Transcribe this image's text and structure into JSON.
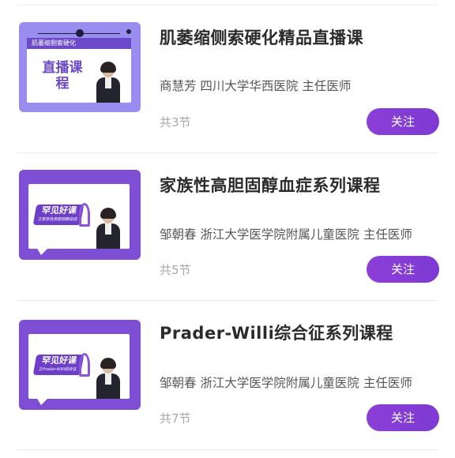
{
  "courses": [
    {
      "title": "肌萎缩侧索硬化精品直播课",
      "lecturer": "商慧芳 四川大学华西医院 主任医师",
      "lessons": "共3节",
      "follow_label": "关注",
      "thumb": {
        "banner": "肌萎缩侧索硬化",
        "tag": "直播课程"
      }
    },
    {
      "title": "家族性高胆固醇血症系列课程",
      "lecturer": "邹朝春 浙江大学医学院附属儿童医院 主任医师",
      "lessons": "共5节",
      "follow_label": "关注",
      "thumb": {
        "badge": "罕见好课",
        "sub": "之家族性高胆固醇血症"
      }
    },
    {
      "title": "Prader-Willi综合征系列课程",
      "lecturer": "邹朝春 浙江大学医学院附属儿童医院 主任医师",
      "lessons": "共7节",
      "follow_label": "关注",
      "thumb": {
        "badge": "罕见好课",
        "sub": "之Prader-Willi综合征"
      }
    }
  ],
  "colors": {
    "accent": "#7f3cd4",
    "thumb_purple": "#7e4fd4",
    "thumb_lavender": "#9a8df0"
  }
}
